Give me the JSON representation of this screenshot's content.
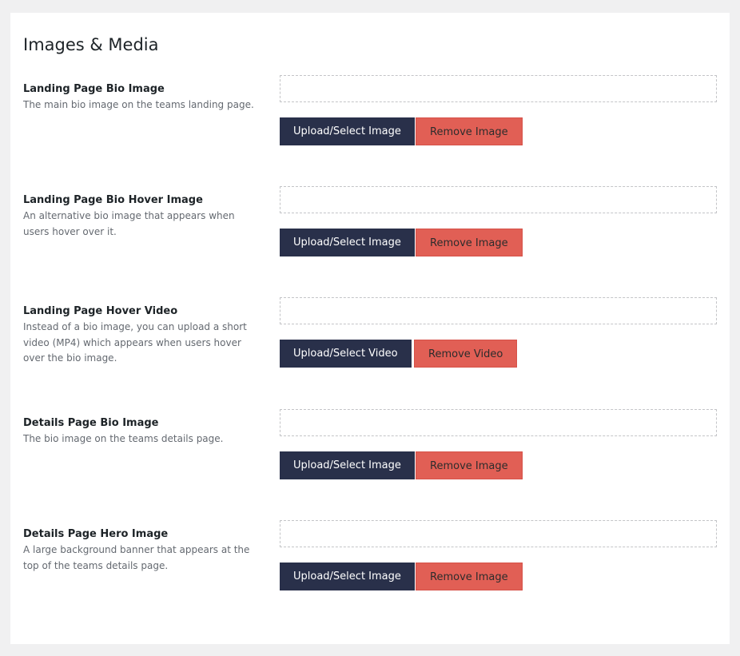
{
  "section": {
    "title": "Images & Media"
  },
  "fields": [
    {
      "label": "Landing Page Bio Image",
      "description": "The main bio image on the teams landing page.",
      "value": "",
      "upload_label": "Upload/Select Image",
      "remove_label": "Remove Image"
    },
    {
      "label": "Landing Page Bio Hover Image",
      "description": "An alternative bio image that appears when users hover over it.",
      "value": "",
      "upload_label": "Upload/Select Image",
      "remove_label": "Remove Image"
    },
    {
      "label": "Landing Page Hover Video",
      "description": "Instead of a bio image, you can upload a short video (MP4) which appears when users hover over the bio image.",
      "value": "",
      "upload_label": "Upload/Select Video",
      "remove_label": "Remove Video"
    },
    {
      "label": "Details Page Bio Image",
      "description": "The bio image on the teams details page.",
      "value": "",
      "upload_label": "Upload/Select Image",
      "remove_label": "Remove Image"
    },
    {
      "label": "Details Page Hero Image",
      "description": "A large background banner that appears at the top of the teams details page.",
      "value": "",
      "upload_label": "Upload/Select Image",
      "remove_label": "Remove Image"
    }
  ],
  "colors": {
    "page_background": "#f0f0f1",
    "panel_background": "#ffffff",
    "upload_button": "#29304a",
    "remove_button": "#e15f55"
  }
}
